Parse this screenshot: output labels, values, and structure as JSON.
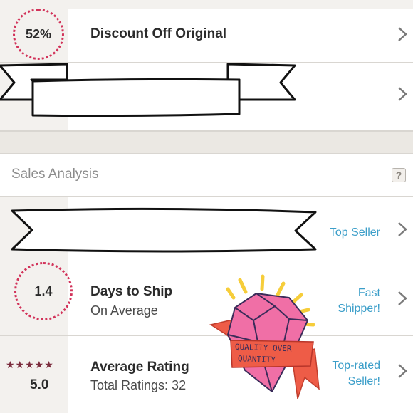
{
  "discount_row": {
    "circle_value": "52%",
    "title": "Discount Off Original"
  },
  "sales_section": {
    "title": "Sales Analysis",
    "help": "?"
  },
  "top_seller_row": {
    "badge": "Top Seller"
  },
  "ship_row": {
    "circle_value": "1.4",
    "title": "Days to Ship",
    "subtitle": "On Average",
    "badge_line1": "Fast",
    "badge_line2": "Shipper!"
  },
  "rating_row": {
    "stars": "★★★★★",
    "value": "5.0",
    "title": "Average Rating",
    "subtitle": "Total Ratings: 32",
    "badge_line1": "Top-rated",
    "badge_line2": "Seller!"
  },
  "sticker": {
    "line1": "QUALITY OVER",
    "line2": "QUANTITY"
  },
  "colors": {
    "accent_dots": "#d2335a",
    "link_blue": "#3b9ec9",
    "star_color": "#7a2b3c",
    "gem_pink": "#f06fa6",
    "ribbon_red": "#ee5c47",
    "sparkle_yellow": "#f6cd3a"
  },
  "icons": {
    "chevron": "chevron-right-icon",
    "help": "help-icon",
    "gem": "diamond-icon"
  }
}
